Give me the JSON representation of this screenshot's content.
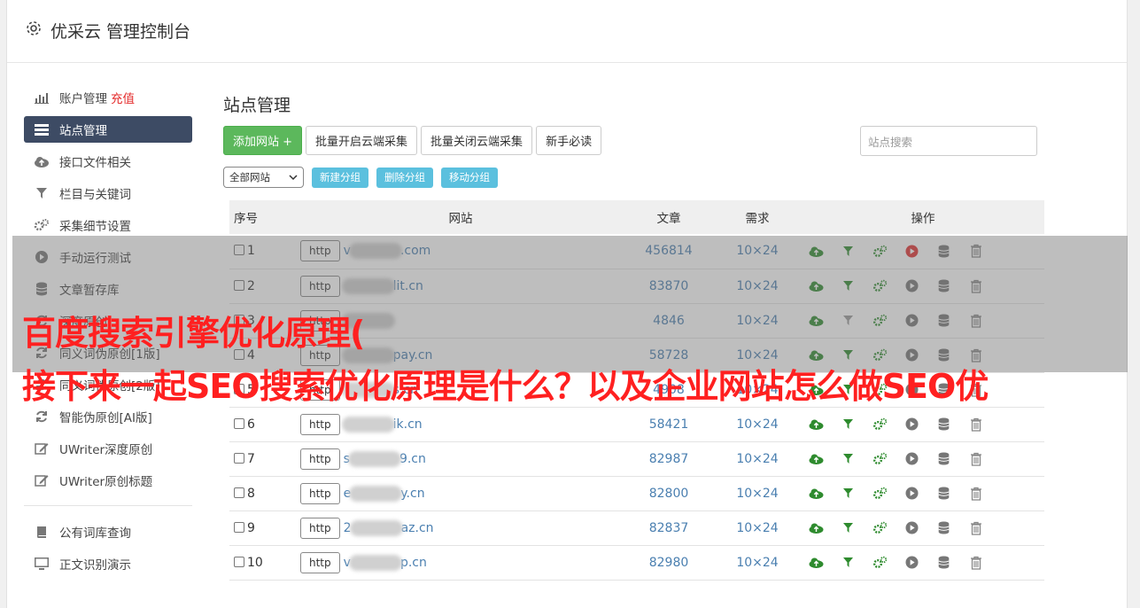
{
  "header": {
    "title": "优采云 管理控制台",
    "icon": "gear-icon"
  },
  "sidebar": {
    "items": [
      {
        "label": "账户管理",
        "badge": "充值",
        "icon": "bar-chart-icon"
      },
      {
        "label": "站点管理",
        "icon": "list-icon",
        "active": true
      },
      {
        "label": "接口文件相关",
        "icon": "cloud-upload-icon"
      },
      {
        "label": "栏目与关键词",
        "icon": "filter-icon"
      },
      {
        "label": "采集细节设置",
        "icon": "gears-icon"
      },
      {
        "label": "手动运行测试",
        "icon": "play-circle-icon"
      },
      {
        "label": "文章暂存库",
        "icon": "database-icon"
      },
      {
        "label": "深度原创",
        "icon": "refresh-icon"
      },
      {
        "label": "同义词伪原创[1版]",
        "icon": "refresh-icon"
      },
      {
        "label": "同义词伪原创[2版]",
        "icon": "refresh-icon"
      },
      {
        "label": "智能伪原创[AI版]",
        "icon": "refresh-icon"
      },
      {
        "label": "UWriter深度原创",
        "icon": "edit-icon"
      },
      {
        "label": "UWriter原创标题",
        "icon": "edit-icon"
      }
    ],
    "bottom_items": [
      {
        "label": "公有词库查询",
        "icon": "book-icon"
      },
      {
        "label": "正文识别演示",
        "icon": "monitor-icon"
      }
    ]
  },
  "main": {
    "title": "站点管理",
    "buttons": {
      "add": "添加网站 +",
      "batch_open": "批量开启云端采集",
      "batch_close": "批量关闭云端采集",
      "guide": "新手必读"
    },
    "search_placeholder": "站点搜索",
    "group_select": "全部网站",
    "group_buttons": {
      "new": "新建分组",
      "delete": "删除分组",
      "move": "移动分组"
    },
    "table": {
      "headers": {
        "index": "序号",
        "site": "网站",
        "articles": "文章",
        "need": "需求",
        "ops": "操作"
      },
      "http_label": "http",
      "rows": [
        {
          "index": "1",
          "prefix": "v",
          "suffix": ".com",
          "articles": "456814",
          "need": "10×24",
          "play_red": true
        },
        {
          "index": "2",
          "prefix": "",
          "suffix": "lit.cn",
          "articles": "83870",
          "need": "10×24"
        },
        {
          "index": "3",
          "prefix": "",
          "suffix": "",
          "articles": "4846",
          "need": "10×24",
          "filter_gray": true
        },
        {
          "index": "4",
          "prefix": "",
          "suffix": "pay.cn",
          "articles": "58728",
          "need": "10×24"
        },
        {
          "index": "5",
          "prefix": "",
          "suffix": "s.cn",
          "articles": "4908",
          "need": "10×24"
        },
        {
          "index": "6",
          "prefix": "",
          "suffix": "ik.cn",
          "articles": "58421",
          "need": "10×24"
        },
        {
          "index": "7",
          "prefix": "s",
          "suffix": "9.cn",
          "articles": "82987",
          "need": "10×24"
        },
        {
          "index": "8",
          "prefix": "e",
          "suffix": "y.cn",
          "articles": "82800",
          "need": "10×24"
        },
        {
          "index": "9",
          "prefix": "2",
          "suffix": "az.cn",
          "articles": "82837",
          "need": "10×24"
        },
        {
          "index": "10",
          "prefix": "v",
          "suffix": "p.cn",
          "articles": "82980",
          "need": "10×24"
        }
      ]
    }
  },
  "overlay": {
    "line1": "百度搜索引擎优化原理(",
    "line2": "接下来一起SEO搜索优化原理是什么？以及企业网站怎么做SEO优"
  },
  "colors": {
    "accent_green": "#5cb85c",
    "accent_blue": "#5bc0de",
    "sidebar_active": "#3d4b64",
    "link": "#4a7fb0",
    "overlay_text": "#ff2020"
  }
}
